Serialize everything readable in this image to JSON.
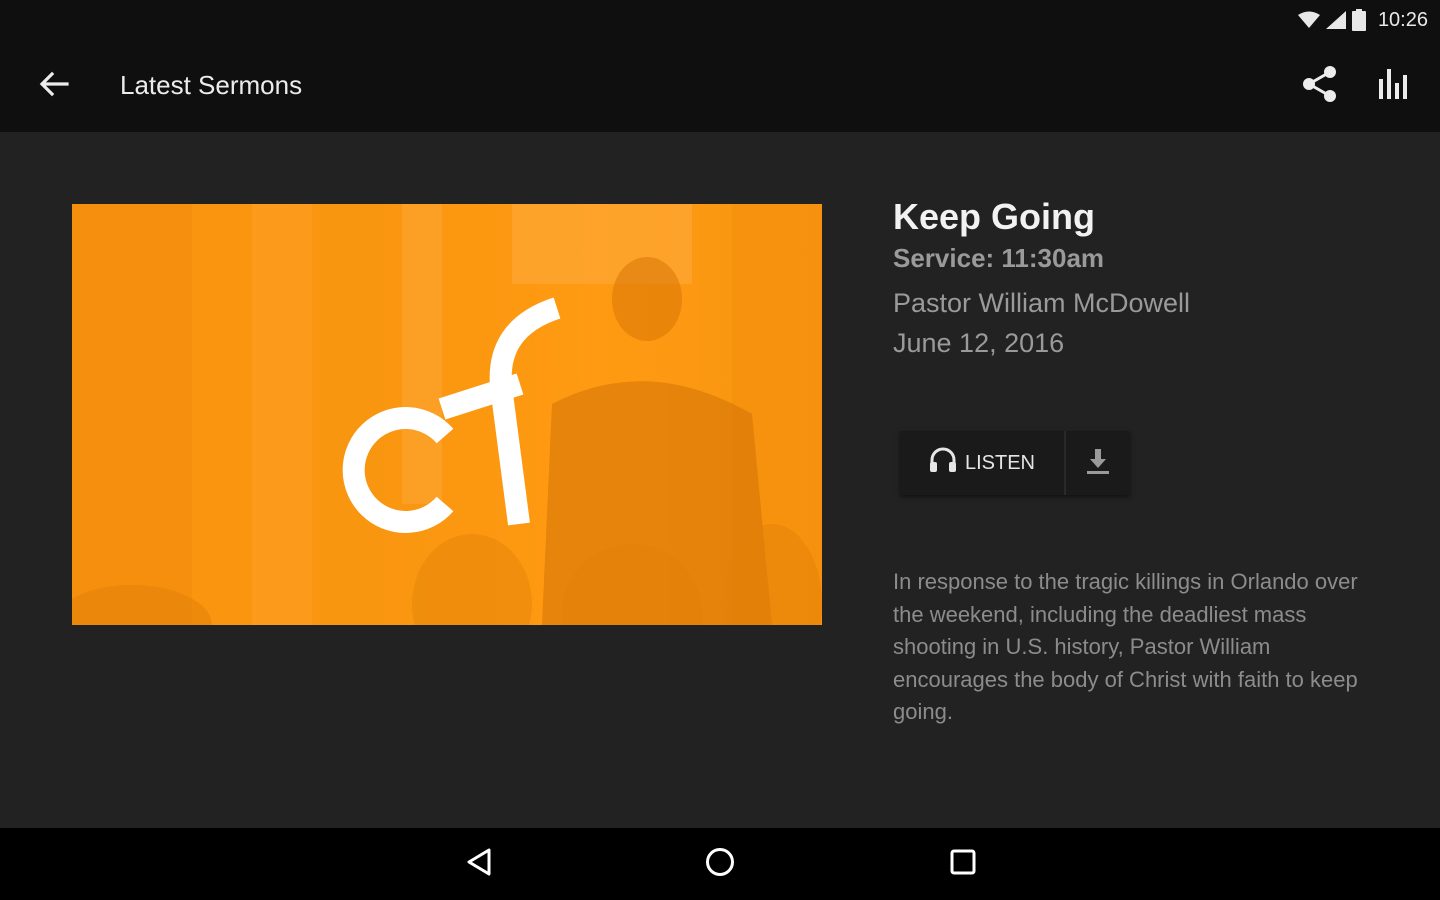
{
  "status_bar": {
    "time": "10:26",
    "icons": [
      "wifi-icon",
      "cell-signal-icon",
      "battery-icon"
    ]
  },
  "app_bar": {
    "title": "Latest Sermons",
    "icons": [
      "back-arrow-icon",
      "share-icon",
      "bar-chart-icon"
    ]
  },
  "sermon": {
    "title": "Keep Going",
    "service": "Service: 11:30am",
    "pastor": "Pastor William McDowell",
    "date": "June 12, 2016",
    "description": "In response to the tragic killings in Orlando over the weekend, including the deadliest mass shooting in U.S. history, Pastor William encourages the body of Christ with faith to keep going."
  },
  "actions": {
    "listen_label": "LISTEN",
    "listen_icon": "headphones-icon",
    "download_icon": "download-icon"
  },
  "artwork": {
    "accent_color": "#fb9410"
  },
  "nav_bar": {
    "icons": [
      "nav-back-icon",
      "nav-home-icon",
      "nav-recents-icon"
    ]
  },
  "colors": {
    "background": "#222222",
    "bars": "#0f0f0f",
    "accent": "#fb9410",
    "title_text": "#f2f2f2",
    "secondary_text": "#9a9a9a"
  }
}
